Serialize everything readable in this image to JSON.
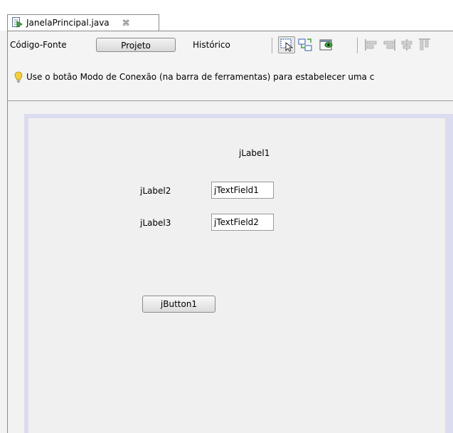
{
  "editor_tab": {
    "title": "JanelaPrincipal.java",
    "close_glyph": "⌘",
    "icon": "java-file-icon"
  },
  "toolbar": {
    "source_label": "Código-Fonte",
    "design_label": "Projeto",
    "history_label": "Histórico",
    "icons": [
      "selection-mode-icon",
      "connection-mode-icon",
      "preview-design-icon",
      "align-left-icon",
      "align-right-icon",
      "center-horizontally-icon",
      "align-top-icon"
    ]
  },
  "hint": {
    "icon": "lightbulb-icon",
    "text": "Use o botão Modo de Conexão (na barra de ferramentas) para estabelecer uma c"
  },
  "form": {
    "label1": "jLabel1",
    "label2": "jLabel2",
    "label3": "jLabel3",
    "field1": "jTextField1",
    "field2": "jTextField2",
    "button1": "jButton1"
  },
  "colors": {
    "form_border": "#dcdcf0",
    "hint_bulb": "#e8c020"
  }
}
